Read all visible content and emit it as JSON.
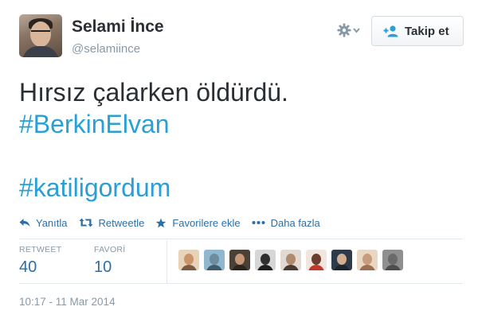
{
  "user": {
    "name": "Selami İnce",
    "handle": "@selamiince"
  },
  "header": {
    "gear_icon": "gear-icon",
    "follow_label": "Takip et",
    "follow_icon": "add-person-icon"
  },
  "tweet": {
    "line1": "Hırsız çalarken öldürdü.",
    "hashtag1": "#BerkinElvan",
    "hashtag2": "#katiligordum"
  },
  "actions": {
    "reply": "Yanıtla",
    "retweet": "Retweetle",
    "favorite": "Favorilere ekle",
    "more": "Daha fazla"
  },
  "stats": {
    "retweet_label": "RETWEET",
    "retweet_count": "40",
    "favorite_label": "FAVORİ",
    "favorite_count": "10"
  },
  "faces_count": 9,
  "timestamp": "10:17 - 11 Mar 2014",
  "colors": {
    "link": "#2a9fd6",
    "action": "#2a6fa8",
    "muted": "#8899a6",
    "text": "#292f33"
  }
}
